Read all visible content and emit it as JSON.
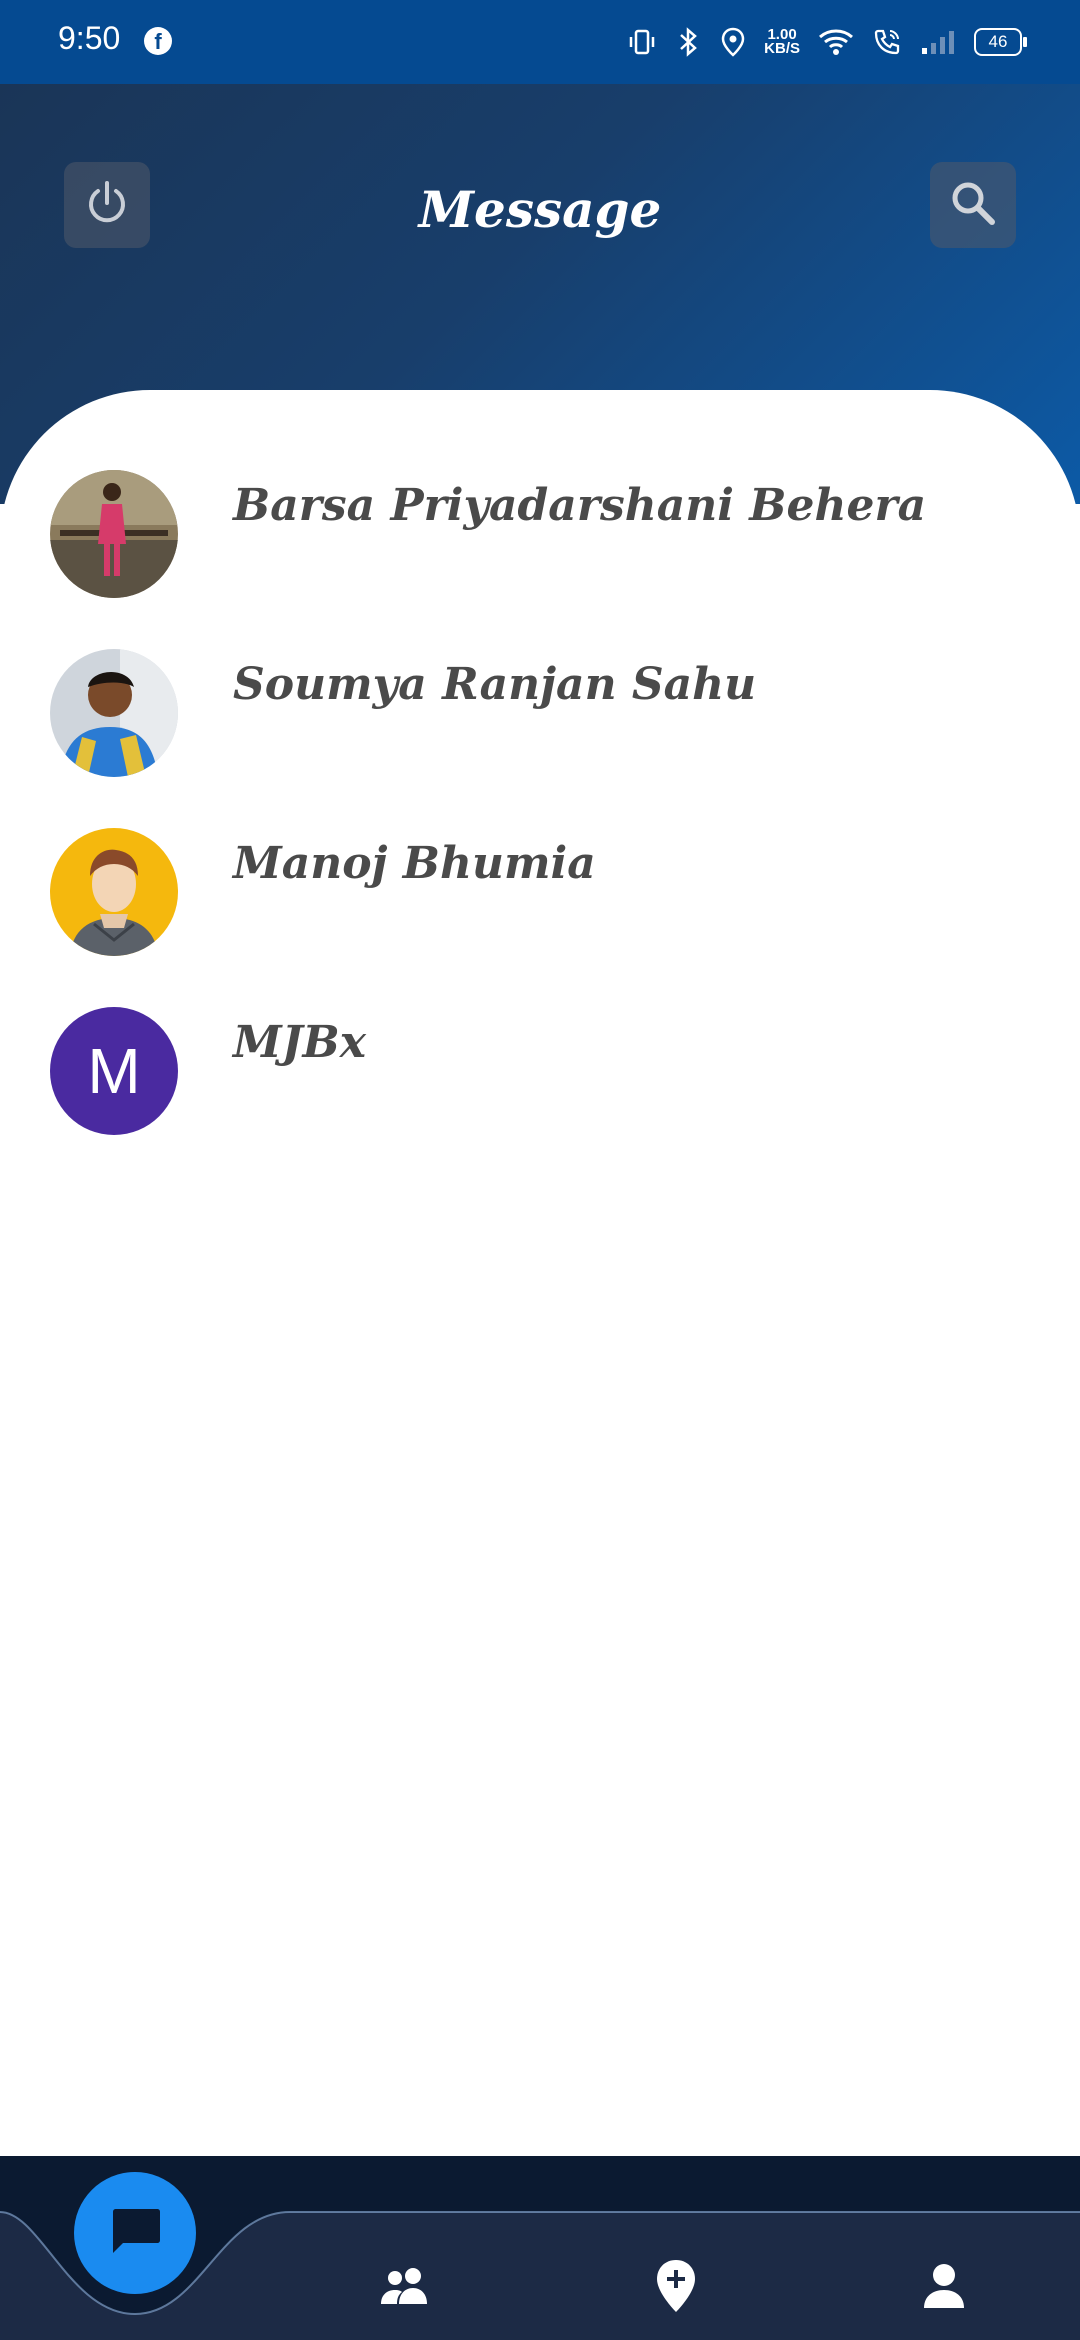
{
  "status_bar": {
    "time": "9:50",
    "app_badge": "f",
    "speed_value": "1.00",
    "speed_unit": "KB/S",
    "battery": "46"
  },
  "header": {
    "title": "Message",
    "power_icon": "power-icon",
    "search_icon": "search-icon"
  },
  "contacts": [
    {
      "name": "Barsa Priyadarshani Behera",
      "avatar": "photo"
    },
    {
      "name": "Soumya Ranjan Sahu",
      "avatar": "photo"
    },
    {
      "name": "Manoj Bhumia",
      "avatar": "default-person"
    },
    {
      "name": "MJBx",
      "avatar": "letter",
      "letter": "M",
      "color": "#4a2aa0"
    }
  ],
  "bottom_nav": {
    "items": [
      "chat-icon",
      "people-icon",
      "add-location-icon",
      "person-icon"
    ],
    "active": "chat-icon",
    "accent": "#1a8bf0"
  }
}
